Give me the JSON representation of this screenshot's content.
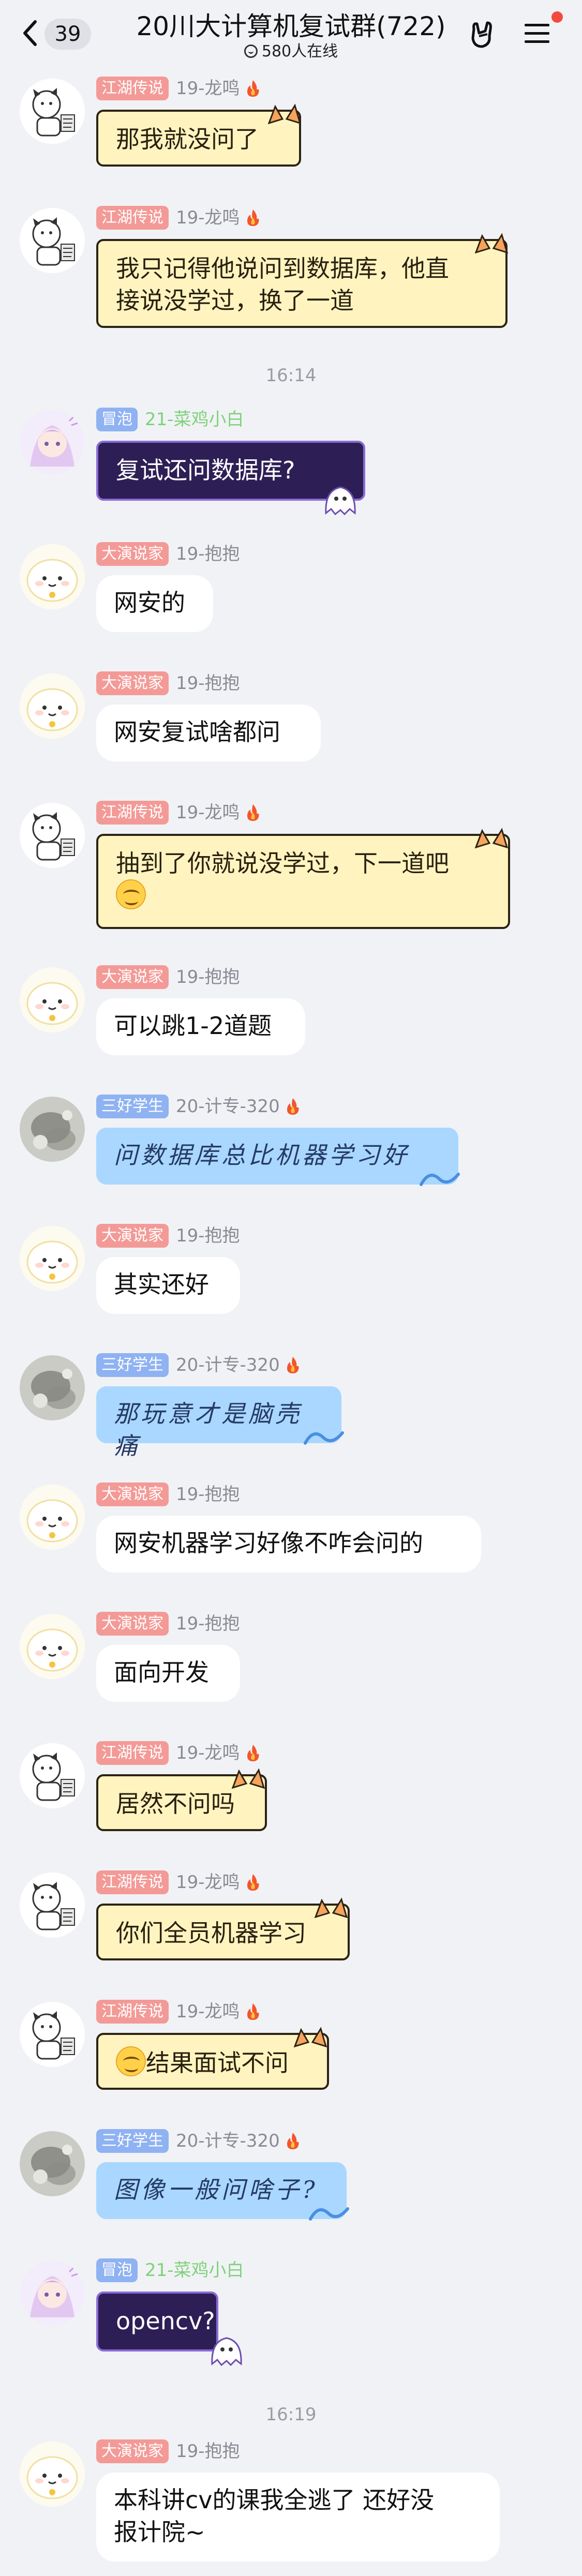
{
  "header": {
    "unread_count": "39",
    "title": "20川大计算机复试群(722)",
    "online": "580人在线"
  },
  "times": [
    "16:14",
    "16:19"
  ],
  "messages": [
    {
      "tag": "江湖传说",
      "level": "19-龙鸣",
      "text": "那我就没问了"
    },
    {
      "tag": "江湖传说",
      "level": "19-龙鸣",
      "text": "我只记得他说问到数据库，他直\n接说没学过，换了一道"
    },
    {
      "tag": "冒泡",
      "level": "21-菜鸡小白",
      "text": "复试还问数据库?"
    },
    {
      "tag": "大演说家",
      "level": "19-抱抱",
      "text": "网安的"
    },
    {
      "tag": "大演说家",
      "level": "19-抱抱",
      "text": "网安复试啥都问"
    },
    {
      "tag": "江湖传说",
      "level": "19-龙鸣",
      "text": "抽到了你就说没学过，下一道吧"
    },
    {
      "tag": "大演说家",
      "level": "19-抱抱",
      "text": "可以跳1-2道题"
    },
    {
      "tag": "三好学生",
      "level": "20-计专-320",
      "text": "问数据库总比机器学习好"
    },
    {
      "tag": "大演说家",
      "level": "19-抱抱",
      "text": "其实还好"
    },
    {
      "tag": "三好学生",
      "level": "20-计专-320",
      "text": "那玩意才是脑壳痛"
    },
    {
      "tag": "大演说家",
      "level": "19-抱抱",
      "text": "网安机器学习好像不咋会问的"
    },
    {
      "tag": "大演说家",
      "level": "19-抱抱",
      "text": "面向开发"
    },
    {
      "tag": "江湖传说",
      "level": "19-龙鸣",
      "text": "居然不问吗"
    },
    {
      "tag": "江湖传说",
      "level": "19-龙鸣",
      "text": "你们全员机器学习"
    },
    {
      "tag": "江湖传说",
      "level": "19-龙鸣",
      "text": "结果面试不问"
    },
    {
      "tag": "三好学生",
      "level": "20-计专-320",
      "text": "图像一般问啥子?"
    },
    {
      "tag": "冒泡",
      "level": "21-菜鸡小白",
      "text": "opencv?"
    },
    {
      "tag": "大演说家",
      "level": "19-抱抱",
      "text": "本科讲cv的课我全逃了 还好没\n报计院~"
    }
  ]
}
